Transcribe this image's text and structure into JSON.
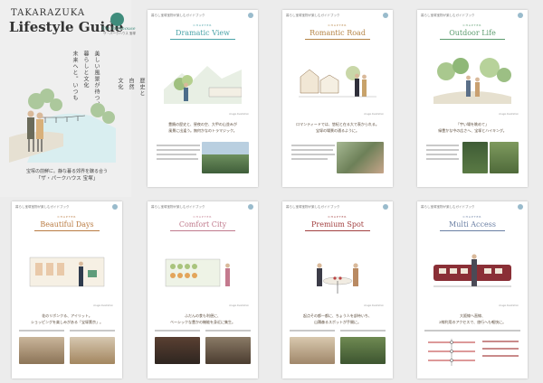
{
  "cover": {
    "pre_title": "TAKARAZUKA",
    "title": "Lifestyle Guide",
    "logo_name": "The Parkhouse",
    "logo_sub": "ザ・パークハウス 宝塚",
    "vertical_left": [
      "美しい風景が待つ、",
      "暮らしと文化",
      "未来へと。いつも"
    ],
    "vertical_right": [
      "歴史と",
      "自然",
      "文化"
    ],
    "tagline_1": "宝塚の前鮮に。静な暮る郊界を醸る合う",
    "tagline_2": "「ザ・パークハウス 宝塚」"
  },
  "pages": [
    {
      "title": "Dramatic View",
      "accent": "#4aa3a8",
      "blurb": [
        "豊饒の歴史と、昼夜の空、大甲の山並みが",
        "風景に出逢う。無何かなのトラマジック。"
      ]
    },
    {
      "title": "Romantic Road",
      "accent": "#b58445",
      "blurb": [
        "ロマンティードでは、悠紀と在る大で表かられる。",
        "宝塚の場景の通るように。"
      ]
    },
    {
      "title": "Outdoor Life",
      "accent": "#5b9b6d",
      "blurb": [
        "「宇い場を眺めて」",
        "緑豊かな中の広さへ、宝塚とハイキング。"
      ]
    },
    {
      "title": "Beautiful Days",
      "accent": "#b97b42",
      "blurb": [
        "花のリボンクる、アイリット。",
        "ショッピングを楽しみがある「宝塚薫京」。"
      ]
    },
    {
      "title": "Comfort City",
      "accent": "#c07a8c",
      "blurb": [
        "ふだんの食も利便に、",
        "ベーシックな豊かの機能を身近に集生。"
      ]
    },
    {
      "title": "Premium Spot",
      "accent": "#a24040",
      "blurb": [
        "起点その都一都に、ちょう人を部待いち、",
        "山積森るスポットが手開に。"
      ]
    },
    {
      "title": "Multi Access",
      "accent": "#6a7fa3",
      "blurb": [
        "大阪線へ直線、",
        "3線利用のアクセスで、旅行へも軽快に。"
      ]
    }
  ],
  "header_text": "暮らし宝塚宝物が楽しむガイドブック",
  "chapter_label": "CHAPTER",
  "credit": "image illustration"
}
